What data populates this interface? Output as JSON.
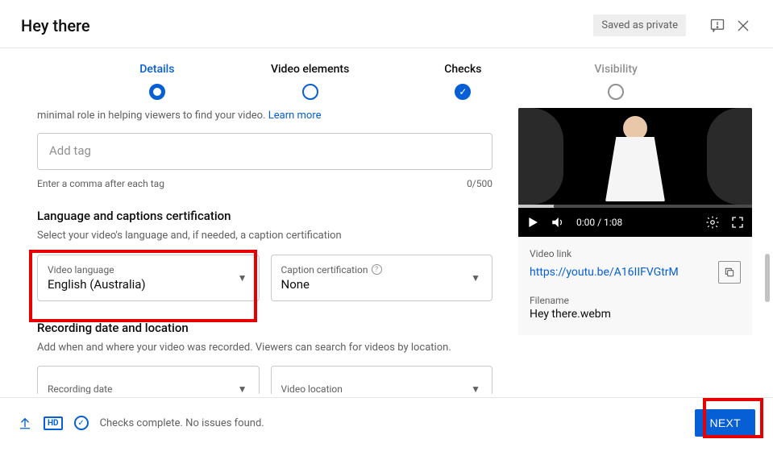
{
  "header": {
    "title": "Hey there",
    "badge": "Saved as private"
  },
  "stepper": {
    "steps": [
      {
        "label": "Details"
      },
      {
        "label": "Video elements"
      },
      {
        "label": "Checks"
      },
      {
        "label": "Visibility"
      }
    ]
  },
  "tags": {
    "intro_suffix": "minimal role in helping viewers to find your video. ",
    "learn_more": "Learn more",
    "placeholder": "Add tag",
    "hint": "Enter a comma after each tag",
    "counter": "0/500"
  },
  "language": {
    "section_title": "Language and captions certification",
    "section_hint": "Select your video's language and, if needed, a caption certification",
    "video_lang_label": "Video language",
    "video_lang_value": "English (Australia)",
    "caption_label": "Caption certification",
    "caption_value": "None"
  },
  "recording": {
    "section_title": "Recording date and location",
    "section_hint": "Add when and where your video was recorded. Viewers can search for videos by location.",
    "date_label": "Recording date",
    "location_label": "Video location"
  },
  "player": {
    "time": "0:00 / 1:08"
  },
  "meta": {
    "link_label": "Video link",
    "link_value": "https://youtu.be/A16IIFVGtrM",
    "file_label": "Filename",
    "file_value": "Hey there.webm"
  },
  "footer": {
    "hd": "HD",
    "status": "Checks complete. No issues found.",
    "next": "NEXT"
  }
}
